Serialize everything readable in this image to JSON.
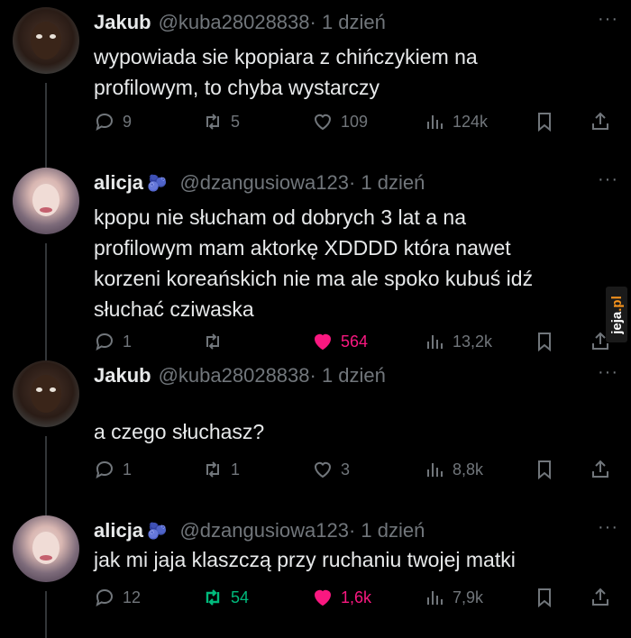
{
  "tweets": [
    {
      "name": "Jakub",
      "badge": "",
      "handle": "@kuba28028838",
      "time": "· 1 dzień",
      "lines": [
        "wypowiada sie kpopiara z chińczykiem na",
        "profilowym, to chyba wystarczy"
      ],
      "replies": "9",
      "retweets": "5",
      "likes": "109",
      "views": "124k",
      "liked": false,
      "retweeted": false
    },
    {
      "name": "alicja",
      "badge": "🫐",
      "handle": "@dzangusiowa123",
      "time": "· 1 dzień",
      "lines": [
        "kpopu nie słucham od dobrych 3 lat a na",
        "profilowym mam aktorkę XDDDD która nawet",
        "korzeni koreańskich nie ma ale spoko kubuś idź",
        "słuchać cziwaska"
      ],
      "replies": "1",
      "retweets": "",
      "likes": "564",
      "views": "13,2k",
      "liked": true,
      "retweeted": false
    },
    {
      "name": "Jakub",
      "badge": "",
      "handle": "@kuba28028838",
      "time": "· 1 dzień",
      "lines": [
        "a czego słuchasz?"
      ],
      "replies": "1",
      "retweets": "1",
      "likes": "3",
      "views": "8,8k",
      "liked": false,
      "retweeted": false
    },
    {
      "name": "alicja",
      "badge": "🫐",
      "handle": "@dzangusiowa123",
      "time": "· 1 dzień",
      "lines": [
        "jak mi jaja klaszczą przy ruchaniu twojej matki"
      ],
      "replies": "12",
      "retweets": "54",
      "likes": "1,6k",
      "views": "7,9k",
      "liked": true,
      "retweeted": true
    }
  ],
  "more_icon": "···",
  "watermark": {
    "text": "jeja",
    "dot": ".pl"
  },
  "colors": {
    "like": "#f91880",
    "retweet": "#00ba7c",
    "muted": "#71767b"
  }
}
